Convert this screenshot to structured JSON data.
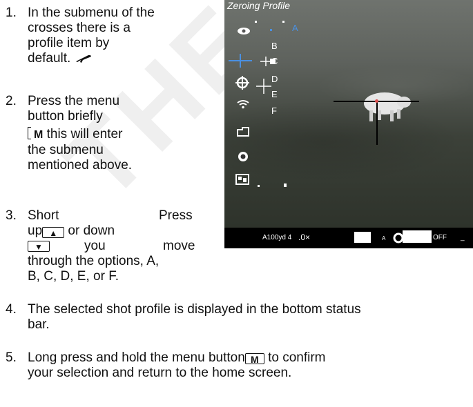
{
  "watermark": "THERE",
  "steps": [
    {
      "num": "1.",
      "lines": [
        "In the submenu of the",
        "crosses there is a",
        "profile item by",
        "default."
      ]
    },
    {
      "num": "2.",
      "lines": [
        "Press the menu",
        "button briefly",
        "this will enter",
        "the submenu",
        "mentioned above."
      ],
      "key_m": "M"
    },
    {
      "num": "3.",
      "line1_left": "Short",
      "line1_right": "Press",
      "line2_prefix": "up",
      "line2_suffix": "or down",
      "line3_mid": "you",
      "line3_right": "move",
      "line4": "through the options, A,",
      "line5": "B, C, D, E, or F.",
      "key_up": "▲",
      "key_down": "▼"
    },
    {
      "num": "4.",
      "line1": "The selected shot profile is displayed in the bottom status",
      "line2": "bar."
    },
    {
      "num": "5.",
      "line1_prefix": "Long press and hold the menu button",
      "line1_suffix": "to confirm",
      "line2": "your selection and return to the home screen.",
      "key_m": "M"
    }
  ],
  "scope": {
    "title": "Zeroing Profile",
    "letters": [
      "A",
      "B",
      "C",
      "D",
      "E",
      "F"
    ],
    "menu_icons": [
      "eye-icon",
      "crosshair-icon",
      "target-icon",
      "wifi-icon",
      "folder-icon",
      "refresh-icon",
      "settings-icon"
    ],
    "status_bar": {
      "profile": "A100yd 4",
      "zoom": ".0×",
      "letter": "A",
      "wifi_state": "OFF",
      "dash": "_"
    }
  }
}
